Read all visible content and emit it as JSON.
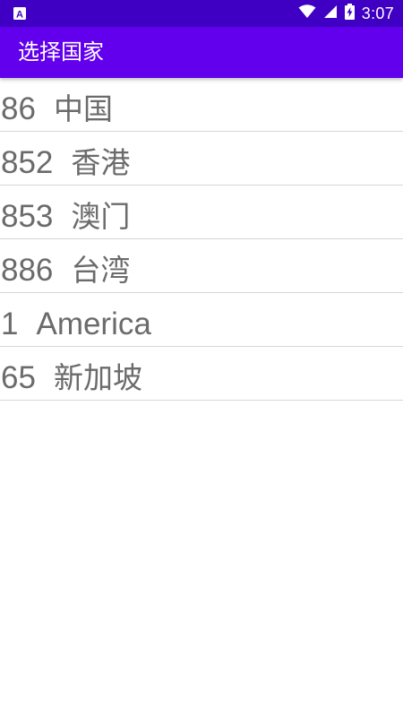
{
  "status_bar": {
    "time": "3:07",
    "icons": [
      "app-notification-icon",
      "wifi-icon",
      "signal-icon",
      "battery-charging-icon"
    ],
    "background_color": "#3f00c4"
  },
  "app_bar": {
    "title": "选择国家",
    "background_color": "#6200ee"
  },
  "countries": [
    {
      "code": "86",
      "name": "中国"
    },
    {
      "code": "852",
      "name": "香港"
    },
    {
      "code": "853",
      "name": "澳门"
    },
    {
      "code": "886",
      "name": "台湾"
    },
    {
      "code": "1",
      "name": "America"
    },
    {
      "code": "65",
      "name": "新加坡"
    }
  ]
}
